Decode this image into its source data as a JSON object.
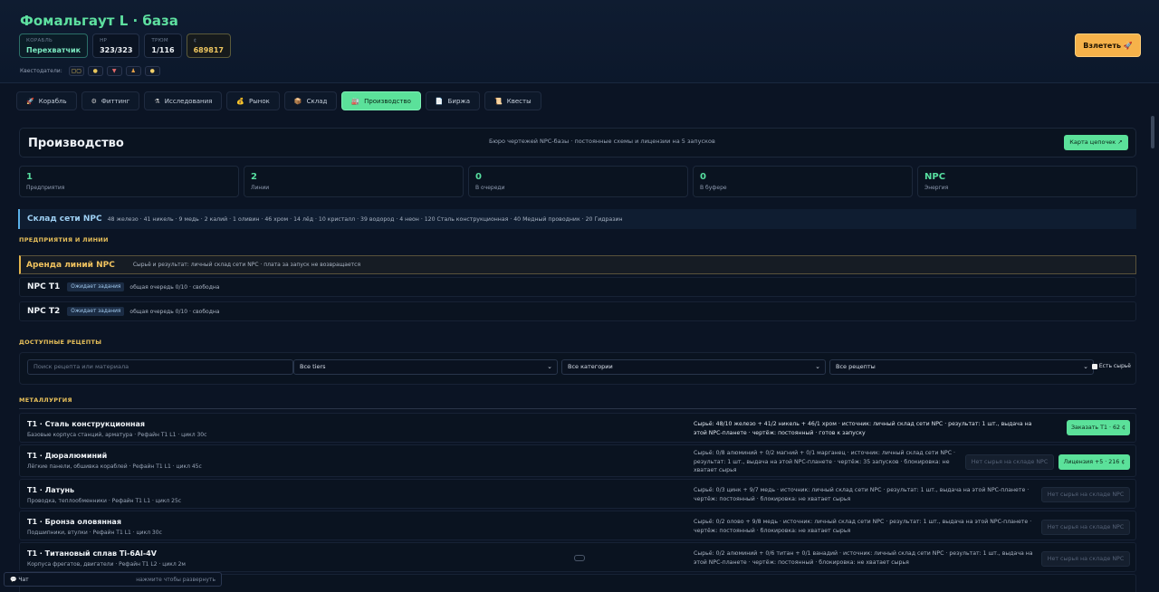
{
  "header": {
    "title": "Фомальгаут L · база",
    "stats": [
      {
        "label": "КОРАБЛЬ",
        "value": "Перехватчик"
      },
      {
        "label": "HP",
        "value": "323/323"
      },
      {
        "label": "ТРЮМ",
        "value": "1/116"
      },
      {
        "label": "¢",
        "value": "689817"
      }
    ],
    "questgivers_label": "Квестодатели:",
    "questgivers": [
      "▢▢",
      "●",
      "▼",
      "♟",
      "●"
    ],
    "takeoff_label": "Взлететь 🚀"
  },
  "tabs": [
    {
      "icon": "🚀",
      "label": "Корабль"
    },
    {
      "icon": "⚙",
      "label": "Фиттинг"
    },
    {
      "icon": "⚗",
      "label": "Исследования"
    },
    {
      "icon": "💰",
      "label": "Рынок"
    },
    {
      "icon": "📦",
      "label": "Склад"
    },
    {
      "icon": "🏭",
      "label": "Производство"
    },
    {
      "icon": "📄",
      "label": "Биржа"
    },
    {
      "icon": "📜",
      "label": "Квесты"
    }
  ],
  "production": {
    "title": "Производство",
    "subtitle": "Бюро чертежей NPC-базы · постоянные схемы и лицензии на 5 запусков",
    "chain_map_label": "Карта цепочек ↗"
  },
  "metrics": [
    {
      "value": "1",
      "label": "Предприятия"
    },
    {
      "value": "2",
      "label": "Линии"
    },
    {
      "value": "0",
      "label": "В очереди"
    },
    {
      "value": "0",
      "label": "В буфере"
    },
    {
      "value": "NPC",
      "label": "Энергия"
    }
  ],
  "stock": {
    "title": "Склад сети NPC",
    "text": "48 железо · 41 никель · 9 медь · 2 калий · 1 оливин · 46 хром · 14 лёд · 10 кристалл · 39 водород · 4 неон · 120 Сталь конструкционная · 40 Медный проводник · 20 Гидразин"
  },
  "sections": {
    "enterprises": "ПРЕДПРИЯТИЯ И ЛИНИИ",
    "recipes": "ДОСТУПНЫЕ РЕЦЕПТЫ",
    "metallurgy": "МЕТАЛЛУРГИЯ"
  },
  "rent": {
    "title": "Аренда линий NPC",
    "text": "Сырьё и результат: личный склад сети NPC · плата за запуск не возвращается"
  },
  "lines": [
    {
      "name": "NPC T1",
      "status": "Ожидает задания",
      "text": "общая очередь 0/10 · свободна"
    },
    {
      "name": "NPC T2",
      "status": "Ожидает задания",
      "text": "общая очередь 0/10 · свободна"
    }
  ],
  "filters": {
    "search_placeholder": "Поиск рецепта или материала",
    "tier": "Все tiers",
    "category": "Все категории",
    "recipes": "Все рецепты",
    "has_raw": "Есть сырьё"
  },
  "recipes": [
    {
      "name": "T1 · Сталь конструкционная",
      "desc": "Базовые корпуса станций, арматура · Рефайн T1 L1 · цикл 30с",
      "info": "Сырьё: 48/10 железо + 41/2 никель + 46/1 хром · источник: личный склад сети NPC · результат: 1 шт., выдача на этой NPC-планете · чертёж: постоянный · готов к запуску",
      "btn1": "Заказать T1 · 62 ¢"
    },
    {
      "name": "T1 · Дюралюминий",
      "desc": "Лёгкие панели, обшивка кораблей · Рефайн T1 L1 · цикл 45с",
      "info": "Сырьё: 0/8 алюминий + 0/2 магний + 0/1 марганец · источник: личный склад сети NPC · результат: 1 шт., выдача на этой NPC-планете · чертёж: 35 запусков · блокировка: не хватает сырья",
      "btn1": "Нет сырья на складе NPC",
      "btn2": "Лицензия +5 · 216 ¢"
    },
    {
      "name": "T1 · Латунь",
      "desc": "Проводка, теплообменники · Рефайн T1 L1 · цикл 25с",
      "info": "Сырьё: 0/3 цинк + 9/7 медь · источник: личный склад сети NPC · результат: 1 шт., выдача на этой NPC-планете · чертёж: постоянный · блокировка: не хватает сырья",
      "btn1": "Нет сырья на складе NPC"
    },
    {
      "name": "T1 · Бронза оловянная",
      "desc": "Подшипники, втулки · Рефайн T1 L1 · цикл 30с",
      "info": "Сырьё: 0/2 олово + 9/8 медь · источник: личный склад сети NPC · результат: 1 шт., выдача на этой NPC-планете · чертёж: постоянный · блокировка: не хватает сырья",
      "btn1": "Нет сырья на складе NPC"
    },
    {
      "name": "T1 · Титановый сплав Ti-6Al-4V",
      "desc": "Корпуса фрегатов, двигатели · Рефайн T1 L2 · цикл 2м",
      "info": "Сырьё: 0/2 алюминий + 0/6 титан + 0/1 ванадий · источник: личный склад сети NPC · результат: 1 шт., выдача на этой NPC-планете · чертёж: постоянный · блокировка: не хватает сырья",
      "btn1": "Нет сырья на складе NPC"
    }
  ],
  "chat": {
    "label": "💬 Чат",
    "hint": "нажмите чтобы развернуть"
  }
}
